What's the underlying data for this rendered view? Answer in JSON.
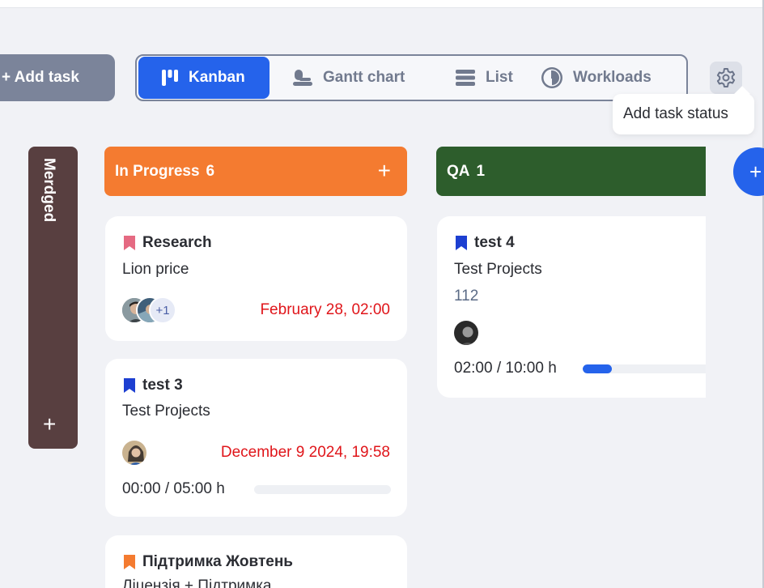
{
  "toolbar": {
    "add_task_label": "+ Add task",
    "views": [
      {
        "label": "Kanban",
        "icon": "kanban-icon",
        "active": true
      },
      {
        "label": "Gantt chart",
        "icon": "gantt-icon",
        "active": false
      },
      {
        "label": "List",
        "icon": "list-icon",
        "active": false
      },
      {
        "label": "Workloads",
        "icon": "clock-icon",
        "active": false
      }
    ],
    "settings_icon": "gear-icon",
    "tooltip": "Add task status"
  },
  "columns": {
    "merged": {
      "title": "Merdged",
      "add_label": "+"
    },
    "in_progress": {
      "title": "In Progress",
      "count": "6",
      "add_label": "+",
      "color": "#f47b30"
    },
    "qa": {
      "title": "QA",
      "count": "1",
      "add_label": "+",
      "color": "#2d5d2c"
    },
    "add_status_label": "+"
  },
  "cards": {
    "research": {
      "title": "Research",
      "project": "Lion price",
      "date": "February 28, 02:00",
      "extra_assignees": "+1",
      "flag_color": "#e56a82"
    },
    "test3": {
      "title": "test 3",
      "project": "Test Projects",
      "date": "December 9 2024, 19:58",
      "time": "00:00 / 05:00 h",
      "progress": 0.0,
      "flag_color": "#1d3fd1"
    },
    "support": {
      "title": "Підтримка Жовтень",
      "project": "Ліцензія + Підтримка",
      "flag_color": "#f47b30"
    },
    "test4": {
      "title": "test 4",
      "project": "Test Projects",
      "number": "112",
      "time": "02:00 / 10:00 h",
      "progress": 0.2,
      "flag_color": "#1d3fd1"
    }
  }
}
